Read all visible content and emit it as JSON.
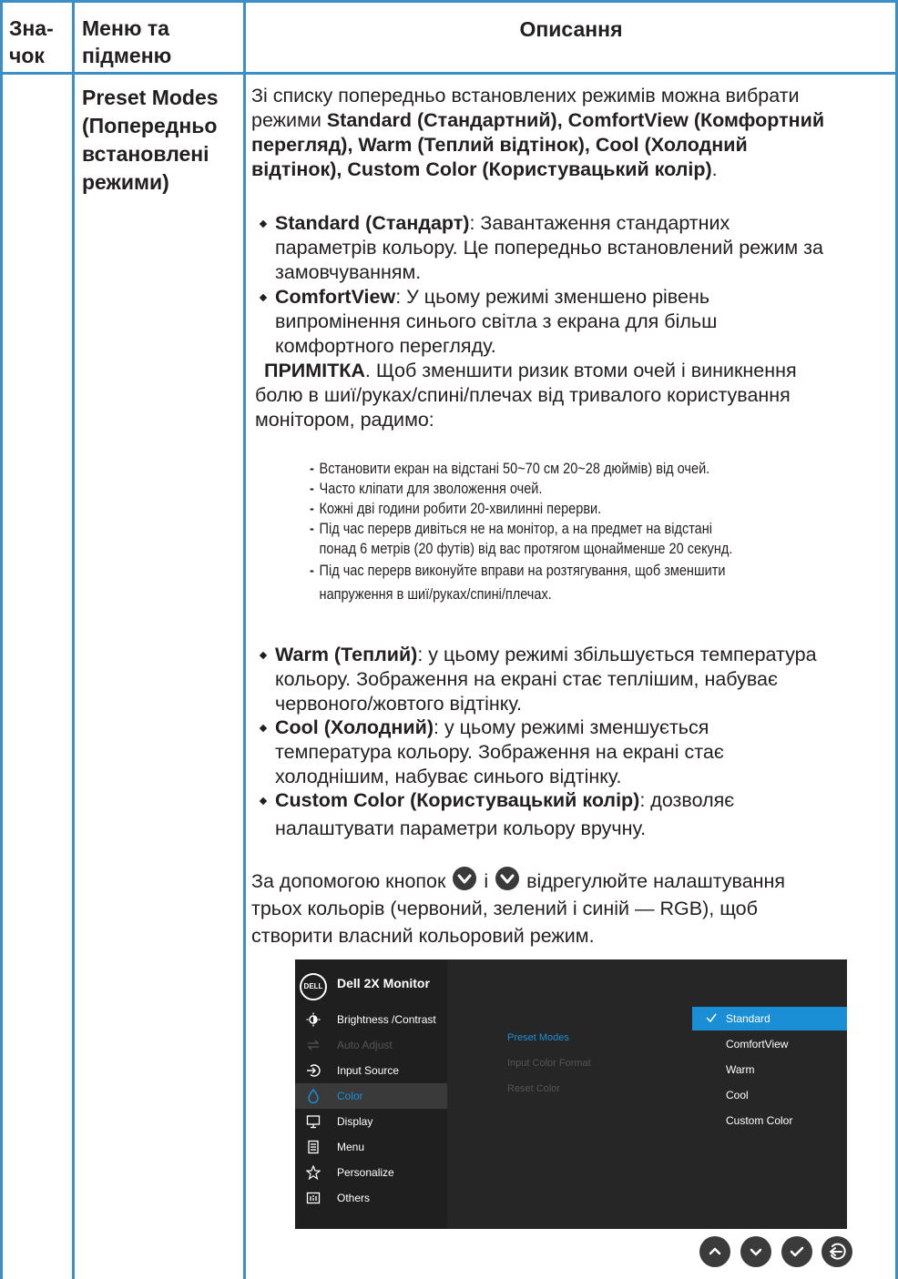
{
  "header": {
    "col_icon": "Зна-\nчок",
    "col_icon_1": "Зна-",
    "col_icon_2": "чок",
    "col_menu_1": "Меню та",
    "col_menu_2": "підменю",
    "col_desc": "Описання"
  },
  "row": {
    "submenu_1": "Preset Modes",
    "submenu_2": "(Попередньо",
    "submenu_3": "встановлені",
    "submenu_4": "режими)"
  },
  "intro": {
    "line1": "Зі списку попередньо встановлених режимів можна вибрати",
    "line2_a": "режими ",
    "line2_b": "Standard (Стандартний), ComfortView (Комфортний",
    "line3_b": "перегляд), Warm (Теплий відтінок), Cool (Холодний",
    "line4_b": "відтінок), Custom Color (Користувацький колір)",
    "line4_c": "."
  },
  "bullets": {
    "standard_title": "Standard (Стандарт)",
    "standard_text1": ": Завантаження стандартних",
    "standard_text2": "параметрів кольору. Це попередньо встановлений режим за",
    "standard_text3": "замовчуванням.",
    "comfort_title": "ComfortView",
    "comfort_text1": ": У цьому режимі зменшено рівень",
    "comfort_text2": "випромінення синього світла з екрана для більш",
    "comfort_text3": "комфортного перегляду.",
    "warm_title": "Warm (Теплий)",
    "warm_text1": ": у цьому режимі збільшується температура",
    "warm_text2": "кольору. Зображення на екрані стає теплішим, набуває",
    "warm_text3": "червоного/жовтого відтінку.",
    "cool_title": "Cool (Холодний)",
    "cool_text1": ": у цьому режимі зменшується",
    "cool_text2": "температура кольору. Зображення на екрані стає",
    "cool_text3": "холоднішим, набуває синього відтінку.",
    "custom_title": "Custom Color (Користувацький колір)",
    "custom_text1": ": дозволяє",
    "custom_text2": "налаштувати параметри кольору вручну."
  },
  "note": {
    "label": "ПРИМІТКА",
    "text1": ". Щоб зменшити ризик втоми очей і виникнення",
    "text2": "болю в шиї/руках/спині/плечах від тривалого користування",
    "text3": "монітором, радимо:"
  },
  "tips": [
    "Встановити екран на відстані 50~70 см 20~28 дюймів) від очей.",
    "Часто кліпати для зволоження очей.",
    "Кожні дві години робити 20-хвилинні перерви.",
    "Під час перерв дивіться не на монітор, а на предмет на відстані",
    "понад 6 метрів (20 футів) від вас протягом щонайменше 20 секунд.",
    "Під час перерв виконуйте вправи на розтягування, щоб зменшити",
    "напруження в шиї/руках/спині/плечах."
  ],
  "tips_dash": "-",
  "nav": {
    "text_a": "За допомогою кнопок ",
    "text_b": " і ",
    "text_c": " відрегулюйте налаштування",
    "text2": "трьох кольорів (червоний, зелений і синій — RGB), щоб",
    "text3": "створити власний кольоровий режим."
  },
  "osd": {
    "logo": "DELL",
    "title": "Dell 2X Monitor",
    "menu": [
      {
        "label": "Brightness /Contrast",
        "icon": "brightness-icon"
      },
      {
        "label": "Auto Adjust",
        "icon": "auto-adjust-icon"
      },
      {
        "label": "Input Source",
        "icon": "input-source-icon"
      },
      {
        "label": "Color",
        "icon": "color-icon"
      },
      {
        "label": "Display",
        "icon": "display-icon"
      },
      {
        "label": "Menu",
        "icon": "menu-icon"
      },
      {
        "label": "Personalize",
        "icon": "star-icon"
      },
      {
        "label": "Others",
        "icon": "others-icon"
      }
    ],
    "submenu": [
      "Preset Modes",
      "Input Color Format",
      "Reset Color"
    ],
    "options": [
      "Standard",
      "ComfortView",
      "Warm",
      "Cool",
      "Custom Color"
    ],
    "accent": "#1a8fd6"
  },
  "colors": {
    "border": "#3a8fc8",
    "text": "#231f20"
  }
}
